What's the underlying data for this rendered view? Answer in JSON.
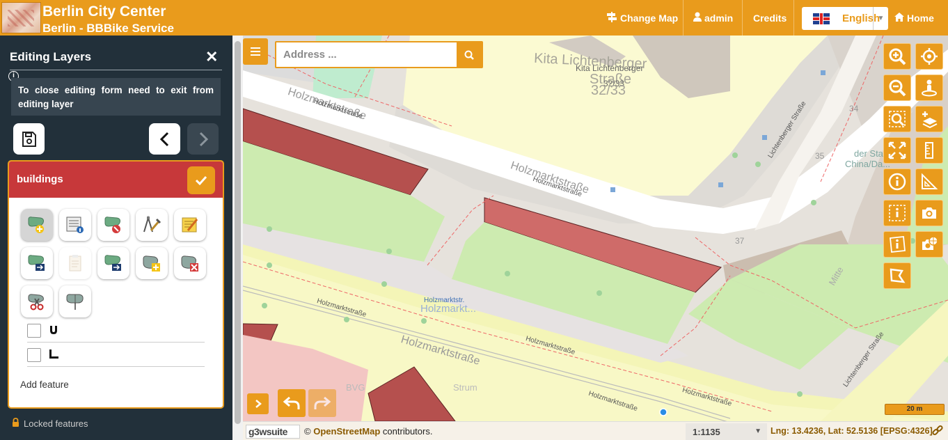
{
  "header": {
    "title": "Berlin City Center",
    "subtitle": "Berlin - BBBike Service",
    "change_map_label": "Change Map",
    "user_label": "admin",
    "credits_label": "Credits",
    "language": "English",
    "home_label": "Home"
  },
  "sidebar": {
    "title": "Editing Layers",
    "info_text": "To close editing form need to exit from editing layer",
    "layer_name": "buildings",
    "add_feature_label": "Add feature",
    "locked_label": "Locked features",
    "tools": [
      "add-feature",
      "edit-attributes",
      "delete-feature",
      "modify-vertex",
      "edit-multiple",
      "copy-feature",
      "copy-to-clipboard",
      "move-feature",
      "add-part",
      "delete-part",
      "split-feature",
      "merge-features"
    ],
    "snap_options": [
      {
        "icon": "magnet-icon",
        "checked": false
      },
      {
        "icon": "ruler-angle-icon",
        "checked": false
      }
    ]
  },
  "map": {
    "search_placeholder": "Address ...",
    "labels": {
      "kita1": "Kita Lichtenberger",
      "kita2": "Kita Lichtenberger",
      "kita_street": "Straße",
      "kita_num1": "32/33",
      "kita_num2": "32/33",
      "holz1": "Holzmarktstraße",
      "holz2": "Holzmarktstraße",
      "holz3": "Holzmarktstraße",
      "holz4": "Holzmarktstraße",
      "holz5": "Holzmarktstraße",
      "holz6": "Holzmarktstraße",
      "holz7": "Holzmarktstraße",
      "holz8": "Holzmarktstraße",
      "holz_big": "Holzmarktstraße",
      "holz_stop": "Holzmarktstr.",
      "holz_stop2": "Holzmarkt...",
      "licht1": "Lichtenberger Straße",
      "licht2": "Lichtenberger Straße",
      "num34": "34",
      "num35": "35",
      "num37": "37",
      "china1": "der Sta...",
      "china2": "China/Da...",
      "mitte": "Mitte",
      "bvg": "BVG",
      "strum": "Strum"
    },
    "scale_bar": "20 m"
  },
  "footer": {
    "logo_text": "g3wsuite",
    "attribution_prefix": "©",
    "attribution_link": "OpenStreetMap",
    "attribution_suffix": "contributors.",
    "scale": "1:1135",
    "coordinates": "Lng: 13.4236, Lat: 52.5136  [EPSG:4326]"
  },
  "colors": {
    "accent": "#e99b1c",
    "sidebar_bg": "#22303a",
    "layer_header": "#c7383a",
    "building_fill": "#b5504e"
  }
}
